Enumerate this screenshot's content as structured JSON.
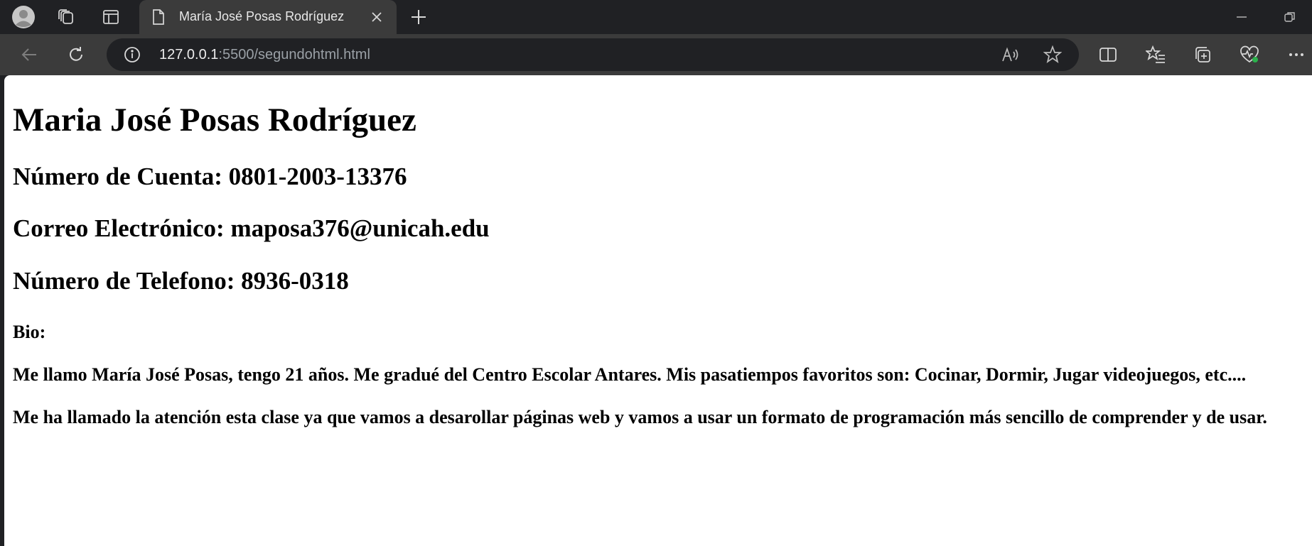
{
  "browser": {
    "tab": {
      "title": "María José Posas Rodríguez"
    },
    "address_bar": {
      "host": "127.0.0.1",
      "path": ":5500/segundohtml.html"
    },
    "icons": {
      "profile": "profile-avatar-icon",
      "workspaces": "workspaces-icon",
      "tab_actions": "tab-actions-icon",
      "page": "page-icon",
      "close_tab": "close-icon",
      "new_tab": "plus-icon",
      "minimize": "minimize-icon",
      "restore": "restore-icon",
      "back": "back-arrow-icon",
      "refresh": "refresh-icon",
      "site_info": "info-icon",
      "read_aloud": "read-aloud-icon",
      "favorite": "star-icon",
      "split_screen": "split-screen-icon",
      "favorites": "favorites-icon",
      "collections": "collections-icon",
      "browser_essentials": "heart-pulse-icon",
      "menu": "more-icon"
    },
    "colors": {
      "frame": "#202124",
      "toolbar": "#3b3b3b",
      "page": "#ffffff"
    }
  },
  "page": {
    "name_heading": "Maria José Posas Rodríguez",
    "account": "Número de Cuenta: 0801-2003-13376",
    "email": "Correo Electrónico: maposa376@unicah.edu",
    "phone": "Número de Telefono: 8936-0318",
    "bio_label": "Bio:",
    "bio_paragraph_1": "Me llamo María José Posas, tengo 21 años. Me gradué del Centro Escolar Antares. Mis pasatiempos favoritos son: Cocinar, Dormir, Jugar videojuegos, etc....",
    "bio_paragraph_2": "Me ha llamado la atención esta clase ya que vamos a desarollar páginas web y vamos a usar un formato de programación más sencillo de comprender y de usar."
  }
}
